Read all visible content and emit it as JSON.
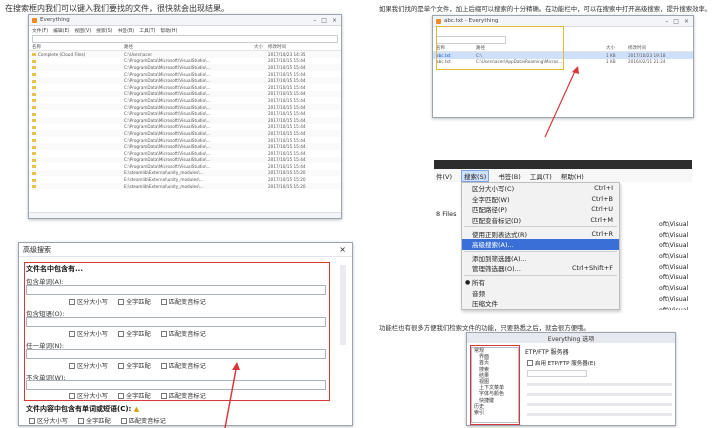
{
  "captions": {
    "top_left": "在搜索框内我们可以键入我们要找的文件，很快就会出现结果。",
    "top_right": "如果我们找的是单个文件，加上后缀可以搜索的十分精确。在功能栏中，可以在搜索中打开高级搜索，提升搜索效率。",
    "mid_right": "功能栏也有很多方便我们检索文件的功能，只要熟悉之后，就会很方便哦。"
  },
  "everything_window": {
    "title": "Everything",
    "menu": [
      "文件(F)",
      "编辑(E)",
      "视图(V)",
      "搜索(S)",
      "书签(B)",
      "工具(T)",
      "帮助(H)"
    ],
    "columns": [
      "名称",
      "路径",
      "大小",
      "修改时间"
    ],
    "rows": [
      {
        "name": "Complete (Cloud Files)",
        "path": "C:\\Users\\acer",
        "date": "2017/10/23 14:35"
      },
      {
        "name": "",
        "path": "C:\\ProgramData\\Microsoft\\VisualStudio\\...",
        "date": "2017/10/15 15:44"
      },
      {
        "name": "",
        "path": "C:\\ProgramData\\Microsoft\\VisualStudio\\...",
        "date": "2017/10/15 15:44"
      },
      {
        "name": "",
        "path": "C:\\ProgramData\\Microsoft\\VisualStudio\\...",
        "date": "2017/10/15 15:44"
      },
      {
        "name": "",
        "path": "C:\\ProgramData\\Microsoft\\VisualStudio\\...",
        "date": "2017/10/15 15:44"
      },
      {
        "name": "",
        "path": "C:\\ProgramData\\Microsoft\\VisualStudio\\...",
        "date": "2017/10/15 15:44"
      },
      {
        "name": "",
        "path": "C:\\ProgramData\\Microsoft\\VisualStudio\\...",
        "date": "2017/10/15 15:44"
      },
      {
        "name": "",
        "path": "C:\\ProgramData\\Microsoft\\VisualStudio\\...",
        "date": "2017/10/15 15:44"
      },
      {
        "name": "",
        "path": "C:\\ProgramData\\Microsoft\\VisualStudio\\...",
        "date": "2017/10/15 15:44"
      },
      {
        "name": "",
        "path": "C:\\ProgramData\\Microsoft\\VisualStudio\\...",
        "date": "2017/10/15 15:44"
      },
      {
        "name": "",
        "path": "C:\\ProgramData\\Microsoft\\VisualStudio\\...",
        "date": "2017/10/15 15:44"
      },
      {
        "name": "",
        "path": "C:\\ProgramData\\Microsoft\\VisualStudio\\...",
        "date": "2017/10/15 15:44"
      },
      {
        "name": "",
        "path": "C:\\ProgramData\\Microsoft\\VisualStudio\\...",
        "date": "2017/10/15 15:44"
      },
      {
        "name": "",
        "path": "C:\\ProgramData\\Microsoft\\VisualStudio\\...",
        "date": "2017/10/15 15:44"
      },
      {
        "name": "",
        "path": "C:\\ProgramData\\Microsoft\\VisualStudio\\...",
        "date": "2017/10/15 15:44"
      },
      {
        "name": "",
        "path": "C:\\ProgramData\\Microsoft\\VisualStudio\\...",
        "date": "2017/10/15 15:44"
      },
      {
        "name": "",
        "path": "C:\\ProgramData\\Microsoft\\VisualStudio\\...",
        "date": "2017/10/15 15:44"
      },
      {
        "name": "",
        "path": "C:\\ProgramData\\Microsoft\\VisualStudio\\...",
        "date": "2017/10/15 15:44"
      },
      {
        "name": "",
        "path": "E:\\steamlib\\External\\unity_modules\\...",
        "date": "2017/10/15 15:20"
      },
      {
        "name": "",
        "path": "E:\\steamlib\\External\\unity_modules\\...",
        "date": "2017/10/15 15:20"
      },
      {
        "name": "",
        "path": "E:\\steamlib\\External\\unity_modules\\...",
        "date": "2017/10/15 15:20"
      }
    ]
  },
  "advanced_dialog": {
    "title": "高级搜索",
    "close": "×",
    "section1": "文件名中包含有...",
    "fields": [
      {
        "label": "包含单词(A):"
      },
      {
        "label": "包含短语(O):"
      },
      {
        "label": "任一单词(N):"
      },
      {
        "label": "不含单词(W):"
      }
    ],
    "options": [
      "区分大小写",
      "全字匹配",
      "匹配变音标记"
    ],
    "section2": "文件内容中包含有单词或短语(C):",
    "bottom_options": [
      "区分大小写",
      "全字匹配",
      "匹配变音标记"
    ]
  },
  "small_window": {
    "title": "abc.txt - Everything",
    "columns": [
      "名称",
      "路径",
      "大小",
      "修改时间"
    ],
    "rows": [
      {
        "name": "abc.txt",
        "path": "C:\\",
        "size": "1 KB",
        "date": "2017/10/23 19:18"
      },
      {
        "name": "abc.txt",
        "path": "C:\\Users\\acer\\AppData\\Roaming\\Micros...",
        "size": "1 KB",
        "date": "2016/02/11 21:24"
      }
    ]
  },
  "search_menu": {
    "menubar": [
      "件(V)",
      "搜索(S)",
      "书签(B)",
      "工具(T)",
      "帮助(H)"
    ],
    "files_count": "8 Files",
    "items": [
      {
        "label": "区分大小写(C)",
        "shortcut": "Ctrl+I"
      },
      {
        "label": "全字匹配(W)",
        "shortcut": "Ctrl+B"
      },
      {
        "label": "匹配路径(P)",
        "shortcut": "Ctrl+U"
      },
      {
        "label": "匹配变音标记(D)",
        "shortcut": "Ctrl+M"
      },
      {
        "label": "使用正则表达式(R)",
        "shortcut": "Ctrl+R"
      },
      {
        "label": "高级搜索(A)...",
        "shortcut": ""
      },
      {
        "label": "添加到筛选器(A)...",
        "shortcut": ""
      },
      {
        "label": "管理筛选器(O)...",
        "shortcut": "Ctrl+Shift+F"
      },
      {
        "label": "所有",
        "shortcut": ""
      },
      {
        "label": "音频",
        "shortcut": ""
      },
      {
        "label": "压缩文件",
        "shortcut": ""
      }
    ],
    "right_column": [
      "oft\\Visual",
      "oft\\Visual",
      "oft\\Visual",
      "oft\\Visual",
      "oft\\Visual",
      "oft\\Visual",
      "oft\\Visual",
      "oft\\Visual",
      "oft\\Visual",
      "oft\\Visual"
    ]
  },
  "options_dialog": {
    "title": "Everything 选项",
    "tree": [
      {
        "label": "常规",
        "indent": false
      },
      {
        "label": "界面",
        "indent": true
      },
      {
        "label": "首页",
        "indent": true
      },
      {
        "label": "搜索",
        "indent": true
      },
      {
        "label": "结果",
        "indent": true
      },
      {
        "label": "视图",
        "indent": true
      },
      {
        "label": "上下文菜单",
        "indent": true
      },
      {
        "label": "字体与颜色",
        "indent": true
      },
      {
        "label": "快捷键",
        "indent": true
      },
      {
        "label": "历史",
        "indent": false
      },
      {
        "label": "索引",
        "indent": false
      }
    ],
    "panel_title": "ETP/FTP 服务器",
    "enable_label": "启用 ETP/FTP 服务器(E)"
  }
}
